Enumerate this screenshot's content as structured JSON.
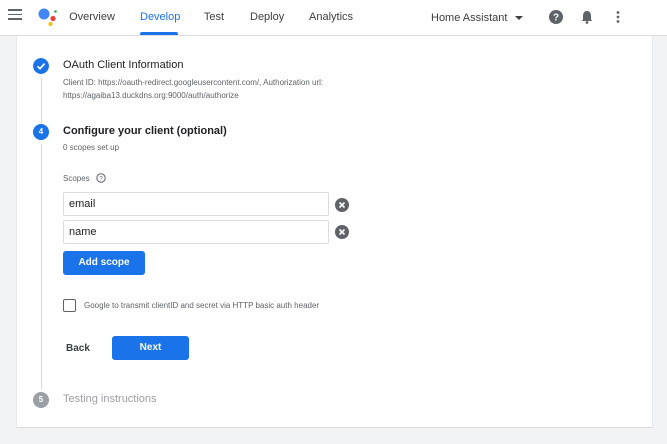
{
  "topbar": {
    "tabs": [
      {
        "label": "Overview"
      },
      {
        "label": "Develop"
      },
      {
        "label": "Test"
      },
      {
        "label": "Deploy"
      },
      {
        "label": "Analytics"
      }
    ],
    "active_tab": "Develop",
    "project": "Home Assistant"
  },
  "steps": {
    "oauth": {
      "title": "OAuth Client Information",
      "detail_line1": "Client ID: https://oauth-redirect.googleusercontent.com/, Authorization url:",
      "detail_line2": "https://agaiba13.duckdns.org:9000/auth/authorize"
    },
    "configure": {
      "number": "4",
      "title": "Configure your client (optional)",
      "subtitle": "0 scopes set up",
      "scopes_label": "Scopes",
      "scopes": [
        {
          "value": "email"
        },
        {
          "value": "name"
        }
      ],
      "add_scope_label": "Add scope",
      "checkbox_label": "Google to transmit clientID and secret via HTTP basic auth header",
      "back_label": "Back",
      "next_label": "Next"
    },
    "testing": {
      "number": "5",
      "title": "Testing instructions"
    }
  },
  "colors": {
    "accent": "#1a73e8",
    "muted_step": "#9aa0a6"
  }
}
